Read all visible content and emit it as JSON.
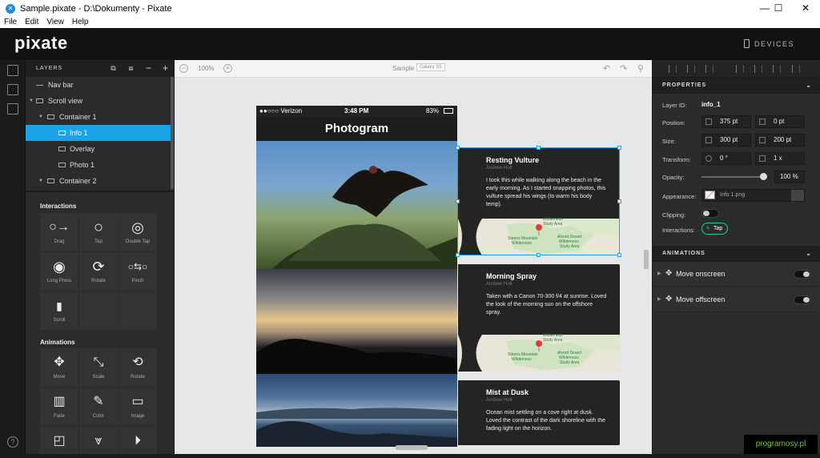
{
  "window": {
    "title": "Sample.pixate - D:\\Dokumenty - Pixate",
    "minimize": "—",
    "maximize": "☐",
    "close": "✕"
  },
  "menu": [
    "File",
    "Edit",
    "View",
    "Help"
  ],
  "app": {
    "logo": "pixate",
    "devices_label": "DEVICES"
  },
  "layers": {
    "title": "LAYERS",
    "items": [
      {
        "label": "Nav bar",
        "indent": 0,
        "selected": false
      },
      {
        "label": "Scroll view",
        "indent": 0,
        "selected": false
      },
      {
        "label": "Container 1",
        "indent": 1,
        "selected": false
      },
      {
        "label": "Info 1",
        "indent": 2,
        "selected": true
      },
      {
        "label": "Overlay",
        "indent": 2,
        "selected": false
      },
      {
        "label": "Photo 1",
        "indent": 2,
        "selected": false
      },
      {
        "label": "Container 2",
        "indent": 1,
        "selected": false
      }
    ]
  },
  "interactions": {
    "title": "Interactions",
    "items": [
      "Drag",
      "Tap",
      "Double Tap",
      "Long Press",
      "Rotate",
      "Pinch",
      "Scroll"
    ]
  },
  "animations": {
    "title": "Animations",
    "items": [
      "Move",
      "Scale",
      "Rotate",
      "Fade",
      "Color",
      "Image"
    ]
  },
  "canvas": {
    "zoom": "100%",
    "doc_name": "Sample",
    "device": "Galaxy S5"
  },
  "phone": {
    "carrier": "●●○○○ Verizon",
    "time": "3:48 PM",
    "battery": "83%",
    "nav_title": "Photogram"
  },
  "cards": [
    {
      "title": "Resting Vulture",
      "author": "Andrew Holt",
      "body": "I took this while walking along the beach in the early morning. As I started snapping photos, this vulture spread his wings (to warm his body temp).",
      "map_labels": [
        "Wilderness",
        "Study Area",
        "Steens Mountain",
        "Wilderness",
        "Alvord Desert",
        "Wilderness",
        "Study Area"
      ]
    },
    {
      "title": "Morning Spray",
      "author": "Andrew Holt",
      "body": "Taken with a Canon 70-300 f/4 at sunrise. Loved the look of the morning sun on the offshore spray.",
      "map_labels": [
        "Wilderness",
        "Study Area",
        "Steens Mountain",
        "Wilderness",
        "Alvord Desert",
        "Wilderness",
        "Study Area"
      ]
    },
    {
      "title": "Mist at Dusk",
      "author": "Andrew Holt",
      "body": "Ocean mist settling on a cove right at dusk. Loved the contrast of the dark shoreline with the fading light on the horizon."
    }
  ],
  "properties": {
    "title": "PROPERTIES",
    "layer_id_label": "Layer ID:",
    "layer_id": "info_1",
    "position_label": "Position:",
    "pos_x": "375 pt",
    "pos_y": "0 pt",
    "size_label": "Size:",
    "width": "300 pt",
    "height": "200 pt",
    "transform_label": "Transform:",
    "rotation": "0 °",
    "scale": "1 x",
    "opacity_label": "Opacity:",
    "opacity": "100 %",
    "opacity_value": 1.0,
    "appearance_label": "Appearance:",
    "appearance_file": "Info 1.png",
    "clipping_label": "Clipping:",
    "interactions_label": "Interactions:",
    "interaction_badge": "Tap"
  },
  "animations_panel": {
    "title": "ANIMATIONS",
    "items": [
      "Move onscreen",
      "Move offscreen"
    ]
  },
  "watermark": "programosy.pl",
  "colors": {
    "selection": "#1aa3e8",
    "accent_green": "#2ecc8a",
    "watermark_green": "#7cc43a"
  }
}
